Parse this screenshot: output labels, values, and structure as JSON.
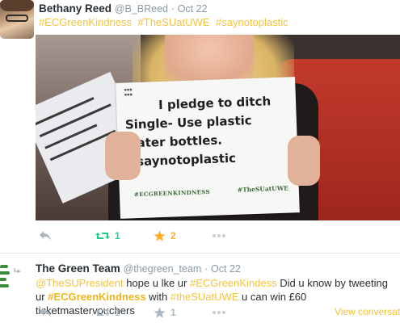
{
  "tweet1": {
    "name": "Bethany Reed",
    "handle": "@B_BReed",
    "separator": "·",
    "date": "Oct 22",
    "hashtags": [
      "#ECGreenKindness",
      "#TheSUatUWE",
      "#saynotoplastic"
    ],
    "sign": {
      "lines": [
        "I pledge to ditch",
        "Single- Use plastic",
        "water bottles.",
        "#saynotoplastic"
      ],
      "tag_left": "#ECGREENKINDNESS",
      "tag_right": "#TheSUatUWE"
    },
    "retweets": "1",
    "favorites": "2"
  },
  "tweet2": {
    "name": "The Green Team",
    "handle": "@thegreen_team",
    "separator": "·",
    "date": "Oct 22",
    "body": {
      "mention": "@TheSUPresident",
      "text1": " hope u lke ur ",
      "hash1": "#ECGreenKindess",
      "text2": " Did u know by tweeting ur ",
      "hash2": "#ECGreenKindness",
      "text3": " with ",
      "hash3": "#theSUatUWE",
      "text4": " u can win £60 ticketmastervouchers"
    },
    "retweets": "1",
    "favorites": "1",
    "view_conversation": "View conversation"
  },
  "colors": {
    "accent": "#f5c33b",
    "retweet_active": "#19cf86",
    "favorite_active": "#ffac33",
    "muted": "#8899a6",
    "icon_grey": "#aab8c2"
  }
}
